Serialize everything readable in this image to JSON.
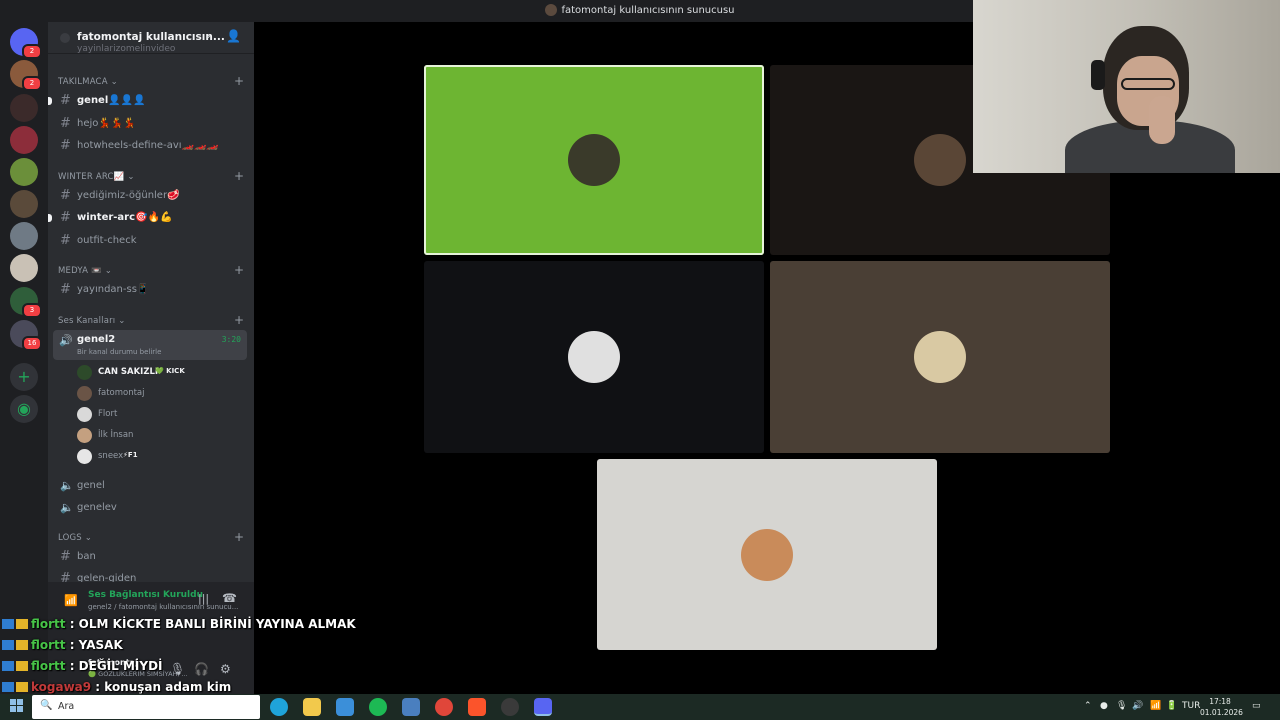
{
  "window": {
    "title": "fatomontaj kullanıcısının sunucusu"
  },
  "guilds": [
    {
      "name": "discord-home",
      "badge": "2",
      "color": "#5865f2"
    },
    {
      "name": "server-1",
      "badge": "2",
      "color": "#8a5a3c"
    },
    {
      "name": "server-2",
      "badge": "",
      "color": "#3b2a2a"
    },
    {
      "name": "server-3",
      "badge": "",
      "color": "#8c2d3a"
    },
    {
      "name": "server-4",
      "badge": "",
      "color": "#6b8f3a"
    },
    {
      "name": "server-5",
      "badge": "",
      "color": "#5a4a3a"
    },
    {
      "name": "server-6",
      "badge": "",
      "color": "#6f7a85"
    },
    {
      "name": "server-7",
      "badge": "",
      "color": "#c9c1b5"
    },
    {
      "name": "server-8",
      "badge": "3",
      "color": "#2f5e3a"
    },
    {
      "name": "server-9",
      "badge": "16",
      "color": "#4a4a5a"
    }
  ],
  "server": {
    "name": "fatomontaj kullanıcısın...",
    "partial_channel": "yayinlarizomelinvideo"
  },
  "categories": {
    "takilmaca": "TAKILMACA",
    "winter_arc": "WINTER ARC📈",
    "medya": "MEDYA 📼",
    "ses": "Ses Kanalları",
    "logs": "LOGS"
  },
  "channels": {
    "genel": "genel👤👤👤",
    "hejo": "hejo💃💃💃",
    "hotwheels": "hotwheels-define-avı🏎️🏎️🏎️",
    "yedigimiz": "yediğimiz-öğünler🥩",
    "winter_arc": "winter-arc🎯🔥💪",
    "outfit": "outfit-check",
    "yayindan": "yayından-ss📱",
    "ban": "ban",
    "gelen": "gelen-giden"
  },
  "voice": {
    "active_channel": "genel2",
    "status_hint": "Bir kanal durumu belirle",
    "duration": "3:20",
    "members": [
      {
        "name": "CAN SAKIZLI",
        "tag": "💚 KICK",
        "color": "#2d4a2a"
      },
      {
        "name": "fatomontaj",
        "tag": "",
        "color": "#6a5446"
      },
      {
        "name": "Flort",
        "tag": "",
        "color": "#d9d9d9"
      },
      {
        "name": "İlk İnsan",
        "tag": "",
        "color": "#c4a080"
      },
      {
        "name": "sneex",
        "tag": "⚡F1",
        "color": "#e6e6e6"
      }
    ],
    "other_channels": [
      "genel",
      "genelev"
    ]
  },
  "voice_panel": {
    "status": "Ses Bağlantısı Kuruldu",
    "subtitle": "genel2 / fatomontaj kullanıcısının sunucu..."
  },
  "user_panel": {
    "name": "fatomontaj",
    "status": "🟢 GÖZLÜKLERİM SİMSİYAH, ..."
  },
  "tiles": [
    {
      "name": "tile-1",
      "bg": "#6db532",
      "speaking": true,
      "avatar": "#3a3a2a"
    },
    {
      "name": "tile-2",
      "bg": "#1a1614",
      "speaking": false,
      "avatar": "#5a4636"
    },
    {
      "name": "tile-3",
      "bg": "#101114",
      "speaking": false,
      "avatar": "#e0e0e0"
    },
    {
      "name": "tile-4",
      "bg": "#4a3f35",
      "speaking": false,
      "avatar": "#d9c9a3"
    },
    {
      "name": "tile-5",
      "bg": "#d6d5d1",
      "speaking": false,
      "avatar": "#c98b5a"
    }
  ],
  "chat": [
    {
      "user": "flortt",
      "message": ": OLM KİCKTE BANLI BİRİNİ YAYINA ALMAK",
      "red": false
    },
    {
      "user": "flortt",
      "message": ": YASAK",
      "red": false
    },
    {
      "user": "flortt",
      "message": ": DEĞİL MİYDİ",
      "red": false
    },
    {
      "user": "kogawa9",
      "message": ": konuşan adam kim",
      "red": true
    }
  ],
  "taskbar": {
    "search_placeholder": "Ara",
    "apps": [
      "edge",
      "files",
      "mail",
      "spotify",
      "calculator",
      "chrome",
      "brave",
      "obs",
      "discord"
    ],
    "tray_lang": "TUR",
    "time": "17:18",
    "date": "01.01.2026"
  }
}
